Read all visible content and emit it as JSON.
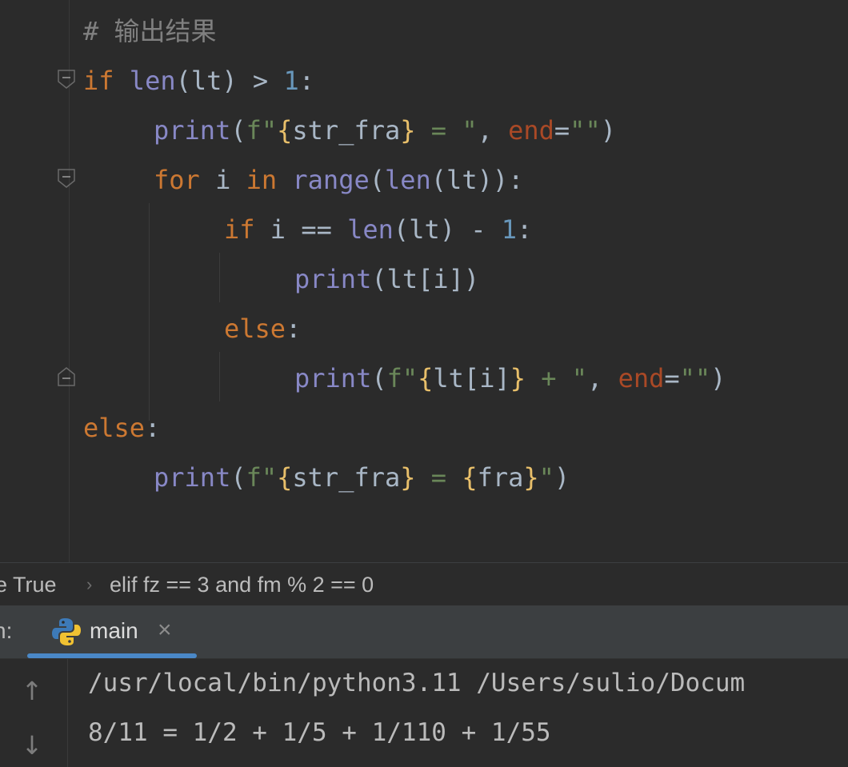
{
  "editor": {
    "lines": [
      {
        "indent": 0,
        "tokens": [
          {
            "t": "cmt",
            "v": "# 输出结果"
          }
        ]
      },
      {
        "indent": 0,
        "tokens": [
          {
            "t": "kw",
            "v": "if "
          },
          {
            "t": "fn",
            "v": "len"
          },
          {
            "t": "plain",
            "v": "(lt) > "
          },
          {
            "t": "num",
            "v": "1"
          },
          {
            "t": "plain",
            "v": ":"
          }
        ]
      },
      {
        "indent": 1,
        "tokens": [
          {
            "t": "fn",
            "v": "print"
          },
          {
            "t": "plain",
            "v": "("
          },
          {
            "t": "str",
            "v": "f\""
          },
          {
            "t": "br",
            "v": "{"
          },
          {
            "t": "plain",
            "v": "str_fra"
          },
          {
            "t": "br",
            "v": "}"
          },
          {
            "t": "str",
            "v": " = \""
          },
          {
            "t": "plain",
            "v": ", "
          },
          {
            "t": "kwarg",
            "v": "end"
          },
          {
            "t": "plain",
            "v": "="
          },
          {
            "t": "str",
            "v": "\"\""
          },
          {
            "t": "plain",
            "v": ")"
          }
        ]
      },
      {
        "indent": 1,
        "tokens": [
          {
            "t": "kw",
            "v": "for "
          },
          {
            "t": "plain",
            "v": "i "
          },
          {
            "t": "kw",
            "v": "in "
          },
          {
            "t": "fn",
            "v": "range"
          },
          {
            "t": "plain",
            "v": "("
          },
          {
            "t": "fn",
            "v": "len"
          },
          {
            "t": "plain",
            "v": "(lt)):"
          }
        ]
      },
      {
        "indent": 2,
        "tokens": [
          {
            "t": "kw",
            "v": "if "
          },
          {
            "t": "plain",
            "v": "i == "
          },
          {
            "t": "fn",
            "v": "len"
          },
          {
            "t": "plain",
            "v": "(lt) - "
          },
          {
            "t": "num",
            "v": "1"
          },
          {
            "t": "plain",
            "v": ":"
          }
        ]
      },
      {
        "indent": 3,
        "tokens": [
          {
            "t": "fn",
            "v": "print"
          },
          {
            "t": "plain",
            "v": "(lt[i])"
          }
        ]
      },
      {
        "indent": 2,
        "tokens": [
          {
            "t": "kw",
            "v": "else"
          },
          {
            "t": "plain",
            "v": ":"
          }
        ]
      },
      {
        "indent": 3,
        "tokens": [
          {
            "t": "fn",
            "v": "print"
          },
          {
            "t": "plain",
            "v": "("
          },
          {
            "t": "str",
            "v": "f\""
          },
          {
            "t": "br",
            "v": "{"
          },
          {
            "t": "plain",
            "v": "lt[i]"
          },
          {
            "t": "br",
            "v": "}"
          },
          {
            "t": "str",
            "v": " + \""
          },
          {
            "t": "plain",
            "v": ", "
          },
          {
            "t": "kwarg",
            "v": "end"
          },
          {
            "t": "plain",
            "v": "="
          },
          {
            "t": "str",
            "v": "\"\""
          },
          {
            "t": "plain",
            "v": ")"
          }
        ]
      },
      {
        "indent": 0,
        "tokens": [
          {
            "t": "kw",
            "v": "else"
          },
          {
            "t": "plain",
            "v": ":"
          }
        ]
      },
      {
        "indent": 1,
        "tokens": [
          {
            "t": "fn",
            "v": "print"
          },
          {
            "t": "plain",
            "v": "("
          },
          {
            "t": "str",
            "v": "f\""
          },
          {
            "t": "br",
            "v": "{"
          },
          {
            "t": "plain",
            "v": "str_fra"
          },
          {
            "t": "br",
            "v": "}"
          },
          {
            "t": "str",
            "v": " = "
          },
          {
            "t": "br",
            "v": "{"
          },
          {
            "t": "plain",
            "v": "fra"
          },
          {
            "t": "br",
            "v": "}"
          },
          {
            "t": "str",
            "v": "\""
          },
          {
            "t": "plain",
            "v": ")"
          }
        ]
      }
    ],
    "colors": {
      "background": "#2b2b2b",
      "comment": "#808080",
      "keyword": "#cc7832",
      "builtin": "#8888c6",
      "number": "#6897bb",
      "string": "#6a8759",
      "fstring_brace": "#e8bf6a",
      "keyword_arg": "#aa4926",
      "plain": "#a9b7c6"
    }
  },
  "breadcrumb": {
    "items": [
      "e True",
      "elif fz == 3 and fm % 2 == 0"
    ],
    "separator": "›"
  },
  "run": {
    "label": "n:",
    "tab_name": "main",
    "tab_icon": "python-icon",
    "close_glyph": "×",
    "accent": "#4a88c7",
    "toolbar": {
      "up_glyph": "↑",
      "down_glyph": "↓"
    },
    "output": [
      "/usr/local/bin/python3.11 /Users/sulio/Docum",
      "8/11 = 1/2 + 1/5 + 1/110 + 1/55"
    ]
  }
}
